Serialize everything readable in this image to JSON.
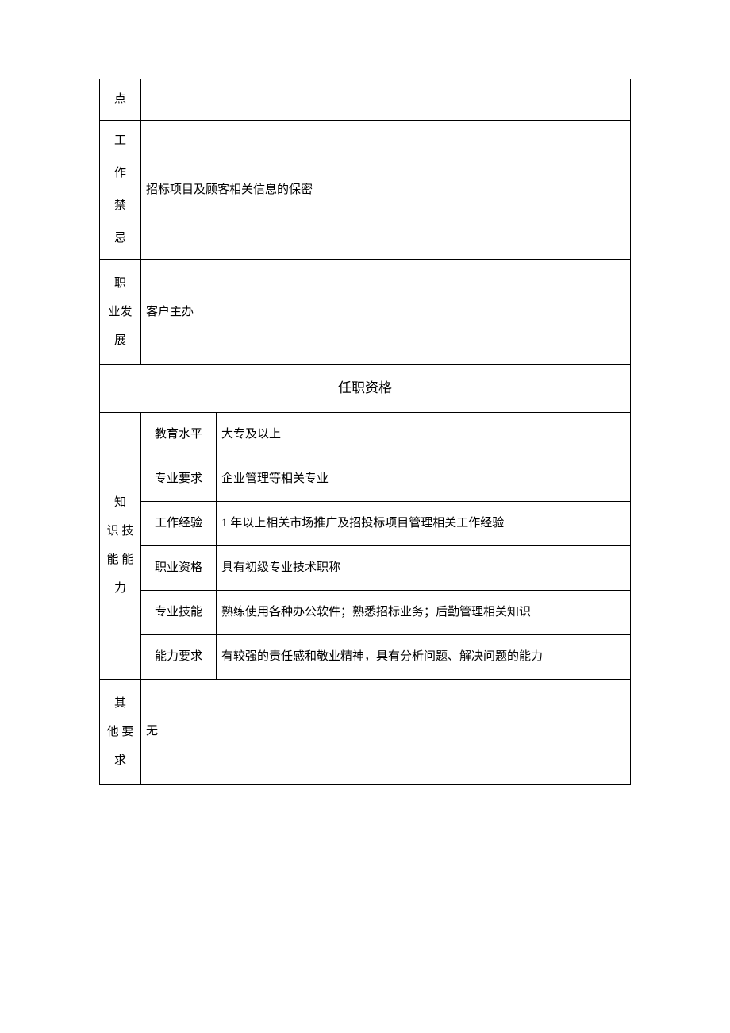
{
  "rows": {
    "dian": {
      "label": "点",
      "value": ""
    },
    "work_taboo": {
      "label_chars": [
        "工",
        "作",
        "禁",
        "忌"
      ],
      "value": "招标项目及顾客相关信息的保密"
    },
    "career_dev": {
      "label_lines": [
        "职",
        "业发",
        "展"
      ],
      "value": "客户主办"
    },
    "qualification_header": "任职资格",
    "knowledge": {
      "label_lines": [
        "知",
        "识 技",
        "能 能",
        "力"
      ],
      "items": [
        {
          "label": "教育水平",
          "value": "大专及以上"
        },
        {
          "label": "专业要求",
          "value": "企业管理等相关专业"
        },
        {
          "label": "工作经验",
          "value": "1 年以上相关市场推广及招投标项目管理相关工作经验"
        },
        {
          "label": "职业资格",
          "value": "具有初级专业技术职称"
        },
        {
          "label": "专业技能",
          "value": "熟练使用各种办公软件；熟悉招标业务；后勤管理相关知识"
        },
        {
          "label": "能力要求",
          "value": "有较强的责任感和敬业精神，具有分析问题、解决问题的能力"
        }
      ]
    },
    "other_req": {
      "label_lines": [
        "其",
        "他 要",
        "求"
      ],
      "value": "无"
    }
  }
}
